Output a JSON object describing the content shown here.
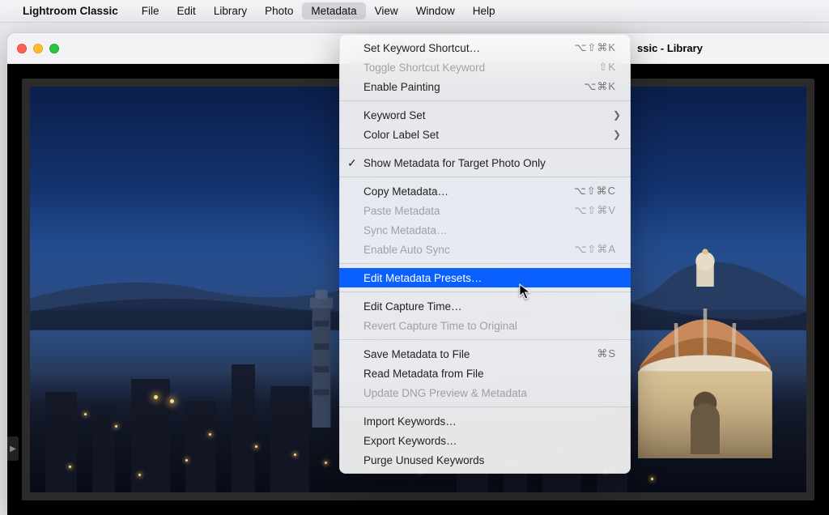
{
  "menubar": {
    "app_name": "Lightroom Classic",
    "items": [
      "File",
      "Edit",
      "Library",
      "Photo",
      "Metadata",
      "View",
      "Window",
      "Help"
    ],
    "open_index": 4
  },
  "window": {
    "title_left": "Classic",
    "title_right": "ssic - Library"
  },
  "dropdown": {
    "items": [
      {
        "label": "Set Keyword Shortcut…",
        "shortcut": "⌥⇧⌘K"
      },
      {
        "label": "Toggle Shortcut Keyword",
        "shortcut": "⇧K",
        "disabled": true
      },
      {
        "label": "Enable Painting",
        "shortcut": "⌥⌘K"
      },
      {
        "sep": true
      },
      {
        "label": "Keyword Set",
        "submenu": true
      },
      {
        "label": "Color Label Set",
        "submenu": true
      },
      {
        "sep": true
      },
      {
        "label": "Show Metadata for Target Photo Only",
        "checked": true
      },
      {
        "sep": true
      },
      {
        "label": "Copy Metadata…",
        "shortcut": "⌥⇧⌘C"
      },
      {
        "label": "Paste Metadata",
        "shortcut": "⌥⇧⌘V",
        "disabled": true
      },
      {
        "label": "Sync Metadata…",
        "disabled": true
      },
      {
        "label": "Enable Auto Sync",
        "shortcut": "⌥⇧⌘A",
        "disabled": true
      },
      {
        "sep": true
      },
      {
        "label": "Edit Metadata Presets…",
        "selected": true
      },
      {
        "sep": true
      },
      {
        "label": "Edit Capture Time…"
      },
      {
        "label": "Revert Capture Time to Original",
        "disabled": true
      },
      {
        "sep": true
      },
      {
        "label": "Save Metadata to File",
        "shortcut": "⌘S"
      },
      {
        "label": "Read Metadata from File"
      },
      {
        "label": "Update DNG Preview & Metadata",
        "disabled": true
      },
      {
        "sep": true
      },
      {
        "label": "Import Keywords…"
      },
      {
        "label": "Export Keywords…"
      },
      {
        "label": "Purge Unused Keywords"
      }
    ]
  }
}
